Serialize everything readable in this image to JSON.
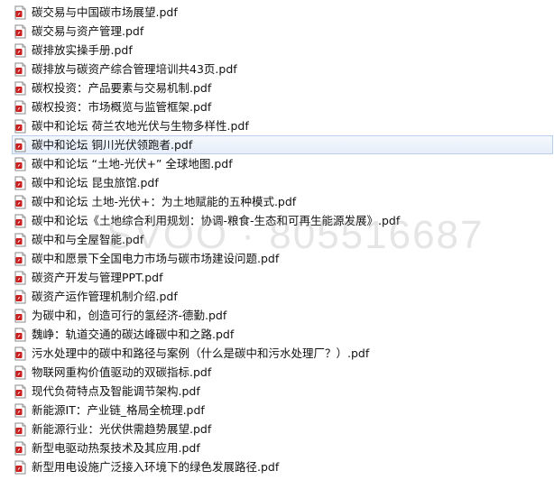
{
  "files": [
    {
      "name": "碳交易与中国碳市场展望.pdf",
      "icon": "pdf-file-icon"
    },
    {
      "name": "碳交易与资产管理.pdf",
      "icon": "pdf-file-icon"
    },
    {
      "name": "碳排放实操手册.pdf",
      "icon": "pdf-file-icon"
    },
    {
      "name": "碳排放与碳资产综合管理培训共43页.pdf",
      "icon": "pdf-file-icon"
    },
    {
      "name": "碳权投资：产品要素与交易机制.pdf",
      "icon": "pdf-file-icon"
    },
    {
      "name": "碳权投资：市场概览与监管框架.pdf",
      "icon": "pdf-file-icon"
    },
    {
      "name": "碳中和论坛  荷兰农地光伏与生物多样性.pdf",
      "icon": "pdf-file-icon"
    },
    {
      "name": "碳中和论坛  铜川光伏领跑者.pdf",
      "icon": "pdf-file-icon",
      "selected": true
    },
    {
      "name": "碳中和论坛  “土地-光伏+”  全球地图.pdf",
      "icon": "pdf-file-icon"
    },
    {
      "name": "碳中和论坛  昆虫旅馆.pdf",
      "icon": "pdf-file-icon"
    },
    {
      "name": "碳中和论坛 土地-光伏+：为土地赋能的五种模式.pdf",
      "icon": "pdf-file-icon"
    },
    {
      "name": "碳中和论坛《土地综合利用规划：协调-粮食-生态和可再生能源发展》.pdf",
      "icon": "pdf-file-icon"
    },
    {
      "name": "碳中和与全屋智能.pdf",
      "icon": "pdf-file-icon"
    },
    {
      "name": "碳中和愿景下全国电力市场与碳市场建设问题.pdf",
      "icon": "pdf-file-icon"
    },
    {
      "name": "碳资产开发与管理PPT.pdf",
      "icon": "pdf-file-icon"
    },
    {
      "name": "碳资产运作管理机制介绍.pdf",
      "icon": "pdf-file-icon"
    },
    {
      "name": "为碳中和，创造可行的氢经济-德勤.pdf",
      "icon": "pdf-file-icon"
    },
    {
      "name": "魏峥：轨道交通的碳达峰碳中和之路.pdf",
      "icon": "pdf-file-icon"
    },
    {
      "name": "污水处理中的碳中和路径与案例（什么是碳中和污水处理厂？）.pdf",
      "icon": "pdf-file-icon"
    },
    {
      "name": "物联网重构价值驱动的双碳指标.pdf",
      "icon": "pdf-file-icon"
    },
    {
      "name": "现代负荷特点及智能调节架构.pdf",
      "icon": "pdf-file-icon"
    },
    {
      "name": "新能源IT：产业链_格局全梳理.pdf",
      "icon": "pdf-file-icon"
    },
    {
      "name": "新能源行业：光伏供需趋势展望.pdf",
      "icon": "pdf-file-icon"
    },
    {
      "name": "新型电驱动热泵技术及其应用.pdf",
      "icon": "pdf-file-icon"
    },
    {
      "name": "新型用电设施广泛接入环境下的绿色发展路径.pdf",
      "icon": "pdf-file-icon"
    }
  ],
  "watermark": "SVOO · 805516687",
  "colors": {
    "selected_bg": "#e6eefa",
    "selected_border": "#b9cfee",
    "pdf_icon_red": "#cc1e1e"
  }
}
